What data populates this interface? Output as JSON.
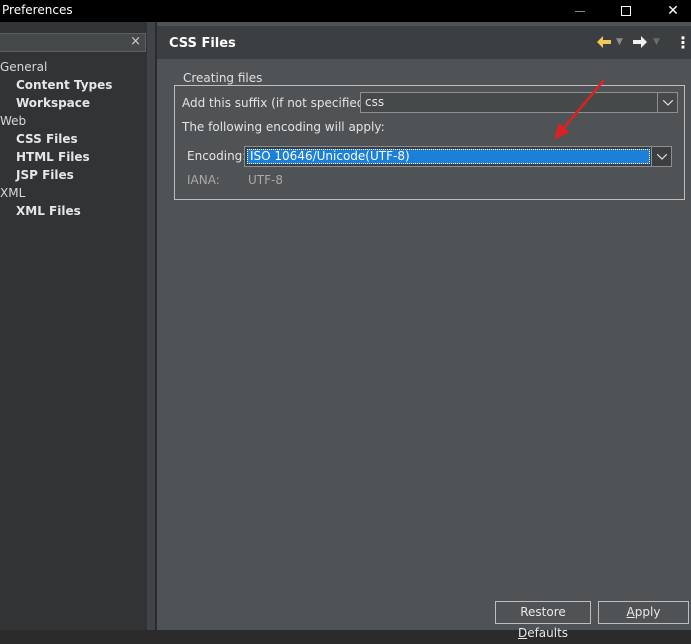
{
  "window": {
    "title": "Preferences",
    "controls": {
      "close_glyph": "✕"
    }
  },
  "sidebar": {
    "filter_placeholder": "",
    "clear_glyph": "×",
    "tree": [
      {
        "label": "General",
        "level": 0
      },
      {
        "label": "Content Types",
        "level": 1
      },
      {
        "label": "Workspace",
        "level": 1
      },
      {
        "label": "Web",
        "level": 0
      },
      {
        "label": "CSS Files",
        "level": 1
      },
      {
        "label": "HTML Files",
        "level": 1
      },
      {
        "label": "JSP Files",
        "level": 1
      },
      {
        "label": "XML",
        "level": 0
      },
      {
        "label": "XML Files",
        "level": 1
      }
    ]
  },
  "page": {
    "title": "CSS Files",
    "nav": {
      "back_icon": "arrow-left",
      "forward_icon": "arrow-right",
      "menu_icon": "vertical-dots"
    },
    "group": {
      "legend": "Creating files",
      "suffix_label": "Add this suffix (if not specified):",
      "suffix_value": "css",
      "encoding_note": "The following encoding will apply:",
      "encoding_label": "Encoding:",
      "encoding_value": "ISO 10646/Unicode(UTF-8)",
      "iana_label": "IANA:",
      "iana_value": "UTF-8"
    },
    "buttons": {
      "restore_defaults": "Restore Defaults",
      "apply": "Apply"
    }
  },
  "colors": {
    "annotation_arrow": "#e02020",
    "selection": "#1c7fd8",
    "back_arrow": "#f1c65a"
  }
}
